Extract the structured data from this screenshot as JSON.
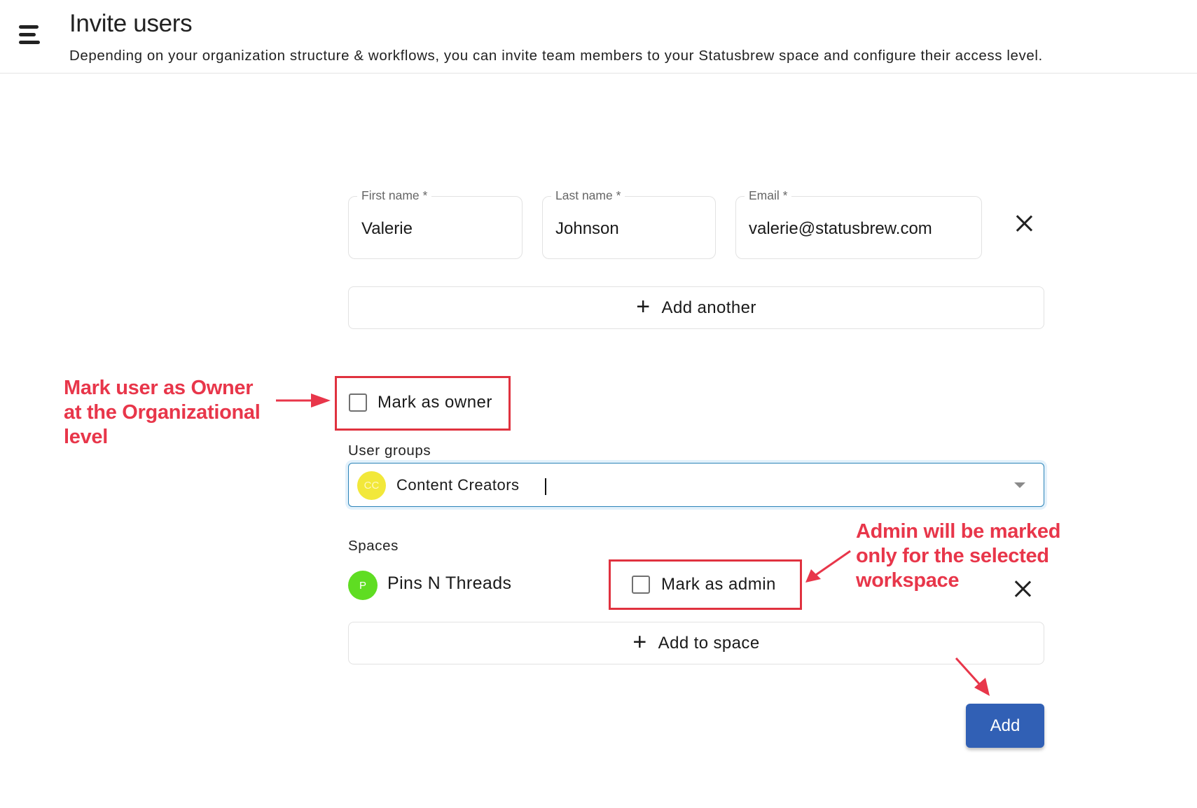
{
  "header": {
    "title": "Invite users",
    "subtitle": "Depending on your organization structure & workflows, you can invite team members to your Statusbrew space and configure their access level."
  },
  "invite_row": {
    "first_name": {
      "label": "First name *",
      "value": "Valerie"
    },
    "last_name": {
      "label": "Last name *",
      "value": "Johnson"
    },
    "email": {
      "label": "Email *",
      "value": "valerie@statusbrew.com"
    }
  },
  "add_another": {
    "icon": "plus-icon",
    "label": "Add another"
  },
  "owner": {
    "label": "Mark as owner",
    "checked": false
  },
  "user_groups": {
    "label": "User groups",
    "selected": [
      {
        "initials": "CC",
        "name": "Content Creators",
        "color": "#f2e83a"
      }
    ]
  },
  "spaces": {
    "label": "Spaces",
    "items": [
      {
        "initial": "P",
        "name": "Pins N Threads",
        "color": "#5fdd22",
        "admin_label": "Mark as admin",
        "admin_checked": false
      }
    ]
  },
  "add_to_space": {
    "icon": "plus-icon",
    "label": "Add to space"
  },
  "submit": {
    "label": "Add",
    "color": "#3160b5"
  },
  "annotations": {
    "owner_note": [
      "Mark user as Owner",
      "at the Organizational",
      "level"
    ],
    "admin_note": [
      "Admin will be marked",
      "only for the selected",
      "workspace"
    ],
    "color": "#e8364a"
  }
}
